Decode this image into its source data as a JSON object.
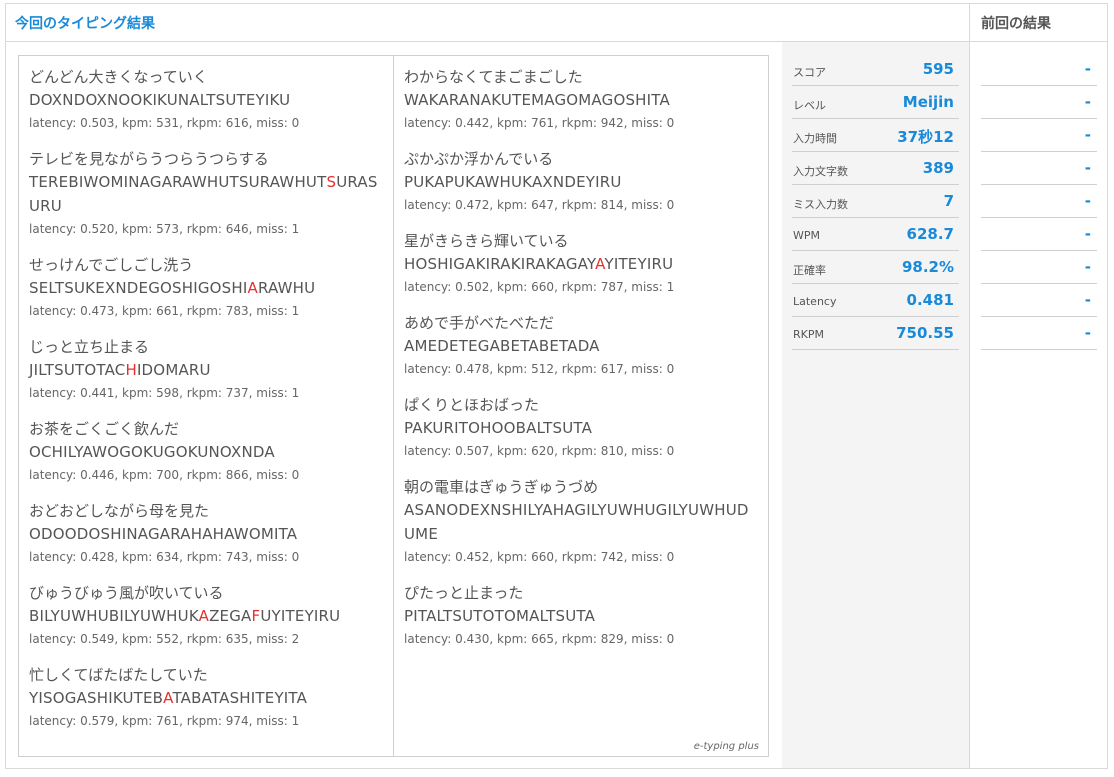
{
  "header": {
    "current_title": "今回のタイピング結果",
    "previous_title": "前回の結果"
  },
  "colors": {
    "accent": "#1a8ad8",
    "miss": "#e53030",
    "panel": "#f4f4f4"
  },
  "results": {
    "left": [
      {
        "japanese": "どんどん大きくなっていく",
        "romaji": [
          {
            "t": "DOXNDOXNOOKIKUNALTSUTEYIKU",
            "m": false
          }
        ],
        "stats": "latency: 0.503, kpm: 531, rkpm: 616, miss: 0"
      },
      {
        "japanese": "テレビを見ながらうつらうつらする",
        "romaji": [
          {
            "t": "TEREBIWOMINAGARAWHUTSURAWHUT",
            "m": false
          },
          {
            "t": "S",
            "m": true
          },
          {
            "t": "URASURU",
            "m": false
          }
        ],
        "stats": "latency: 0.520, kpm: 573, rkpm: 646, miss: 1"
      },
      {
        "japanese": "せっけんでごしごし洗う",
        "romaji": [
          {
            "t": "SELTSUKEXNDEGOSHIGOSHI",
            "m": false
          },
          {
            "t": "A",
            "m": true
          },
          {
            "t": "RAWHU",
            "m": false
          }
        ],
        "stats": "latency: 0.473, kpm: 661, rkpm: 783, miss: 1"
      },
      {
        "japanese": "じっと立ち止まる",
        "romaji": [
          {
            "t": "JILTSUTOTAC",
            "m": false
          },
          {
            "t": "H",
            "m": true
          },
          {
            "t": "IDOMARU",
            "m": false
          }
        ],
        "stats": "latency: 0.441, kpm: 598, rkpm: 737, miss: 1"
      },
      {
        "japanese": "お茶をごくごく飲んだ",
        "romaji": [
          {
            "t": "OCHILYAWOGOKUGOKUNOXNDA",
            "m": false
          }
        ],
        "stats": "latency: 0.446, kpm: 700, rkpm: 866, miss: 0"
      },
      {
        "japanese": "おどおどしながら母を見た",
        "romaji": [
          {
            "t": "ODOODOSHINAGARAHAHAWOMITA",
            "m": false
          }
        ],
        "stats": "latency: 0.428, kpm: 634, rkpm: 743, miss: 0"
      },
      {
        "japanese": "びゅうびゅう風が吹いている",
        "romaji": [
          {
            "t": "BILYUWHUBILYUWHUK",
            "m": false
          },
          {
            "t": "A",
            "m": true
          },
          {
            "t": "ZEGA",
            "m": false
          },
          {
            "t": "F",
            "m": true
          },
          {
            "t": "UYITEYIRU",
            "m": false
          }
        ],
        "stats": "latency: 0.549, kpm: 552, rkpm: 635, miss: 2"
      },
      {
        "japanese": "忙しくてばたばたしていた",
        "romaji": [
          {
            "t": "YISOGASHIKUTEB",
            "m": false
          },
          {
            "t": "A",
            "m": true
          },
          {
            "t": "TABATASHITEYITA",
            "m": false
          }
        ],
        "stats": "latency: 0.579, kpm: 761, rkpm: 974, miss: 1"
      }
    ],
    "right": [
      {
        "japanese": "わからなくてまごまごした",
        "romaji": [
          {
            "t": "WAKARANAKUTEMAGOMAGOSHITA",
            "m": false
          }
        ],
        "stats": "latency: 0.442, kpm: 761, rkpm: 942, miss: 0"
      },
      {
        "japanese": "ぷかぷか浮かんでいる",
        "romaji": [
          {
            "t": "PUKAPUKAWHUKAXNDEYIRU",
            "m": false
          }
        ],
        "stats": "latency: 0.472, kpm: 647, rkpm: 814, miss: 0"
      },
      {
        "japanese": "星がきらきら輝いている",
        "romaji": [
          {
            "t": "HOSHIGAKIRAKIRAKAGAY",
            "m": false
          },
          {
            "t": "A",
            "m": true
          },
          {
            "t": "YITEYIRU",
            "m": false
          }
        ],
        "stats": "latency: 0.502, kpm: 660, rkpm: 787, miss: 1"
      },
      {
        "japanese": "あめで手がべたべただ",
        "romaji": [
          {
            "t": "AMEDETEGABETABETADA",
            "m": false
          }
        ],
        "stats": "latency: 0.478, kpm: 512, rkpm: 617, miss: 0"
      },
      {
        "japanese": "ぱくりとほおばった",
        "romaji": [
          {
            "t": "PAKURITOHOOBALTSUTA",
            "m": false
          }
        ],
        "stats": "latency: 0.507, kpm: 620, rkpm: 810, miss: 0"
      },
      {
        "japanese": "朝の電車はぎゅうぎゅうづめ",
        "romaji": [
          {
            "t": "ASANODEXNSHILYAHAGILYUWHUGILYUWHUDUME",
            "m": false
          }
        ],
        "stats": "latency: 0.452, kpm: 660, rkpm: 742, miss: 0"
      },
      {
        "japanese": "ぴたっと止まった",
        "romaji": [
          {
            "t": "PITALTSUTOTOMALTSUTA",
            "m": false
          }
        ],
        "stats": "latency: 0.430, kpm: 665, rkpm: 829, miss: 0"
      }
    ],
    "brand": "e-typing plus"
  },
  "summary": [
    {
      "label": "スコア",
      "value": "595"
    },
    {
      "label": "レベル",
      "value": "Meijin"
    },
    {
      "label": "入力時間",
      "value": "37秒12"
    },
    {
      "label": "入力文字数",
      "value": "389"
    },
    {
      "label": "ミス入力数",
      "value": "7"
    },
    {
      "label": "WPM",
      "value": "628.7"
    },
    {
      "label": "正確率",
      "value": "98.2%"
    },
    {
      "label": "Latency",
      "value": "0.481"
    },
    {
      "label": "RKPM",
      "value": "750.55"
    }
  ],
  "previous": [
    "-",
    "-",
    "-",
    "-",
    "-",
    "-",
    "-",
    "-",
    "-"
  ]
}
